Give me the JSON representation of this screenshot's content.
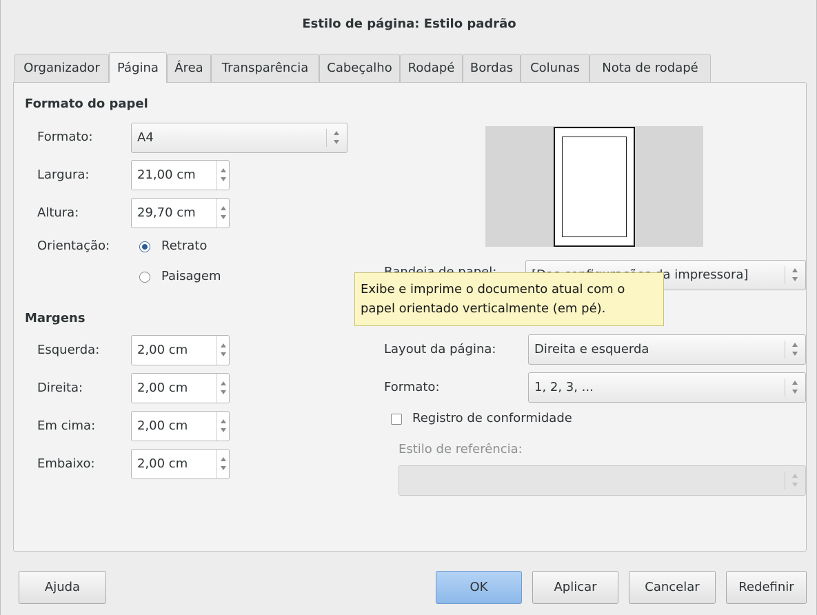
{
  "window": {
    "title": "Estilo de página: Estilo padrão"
  },
  "tabs": [
    {
      "label": "Organizador",
      "active": false
    },
    {
      "label": "Página",
      "active": true
    },
    {
      "label": "Área",
      "active": false
    },
    {
      "label": "Transparência",
      "active": false
    },
    {
      "label": "Cabeçalho",
      "active": false
    },
    {
      "label": "Rodapé",
      "active": false
    },
    {
      "label": "Bordas",
      "active": false
    },
    {
      "label": "Colunas",
      "active": false
    },
    {
      "label": "Nota de rodapé",
      "active": false
    }
  ],
  "paper": {
    "section_title": "Formato do papel",
    "format_label": "Formato:",
    "format_value": "A4",
    "width_label": "Largura:",
    "width_value": "21,00 cm",
    "height_label": "Altura:",
    "height_value": "29,70 cm",
    "orientation_label": "Orientação:",
    "portrait_label": "Retrato",
    "portrait_checked": true,
    "landscape_label": "Paisagem",
    "landscape_checked": false,
    "tray_label": "Bandeja de papel:",
    "tray_value": "[Das configurações da impressora]"
  },
  "margins": {
    "section_title": "Margens",
    "left_label": "Esquerda:",
    "left_value": "2,00 cm",
    "right_label": "Direita:",
    "right_value": "2,00 cm",
    "top_label": "Em cima:",
    "top_value": "2,00 cm",
    "bottom_label": "Embaixo:",
    "bottom_value": "2,00 cm"
  },
  "layout": {
    "page_layout_label": "Layout da página:",
    "page_layout_value": "Direita e esquerda",
    "format_label": "Formato:",
    "format_value": "1, 2, 3, ...",
    "register_label": "Registro de conformidade",
    "register_checked": false,
    "reference_style_label": "Estilo de referência:",
    "reference_style_value": ""
  },
  "tooltip": {
    "text_line1": "Exibe e imprime o documento atual com o",
    "text_line2": "papel orientado verticalmente (em pé)."
  },
  "buttons": {
    "help": "Ajuda",
    "ok": "OK",
    "apply": "Aplicar",
    "cancel": "Cancelar",
    "reset": "Redefinir"
  },
  "colors": {
    "dialog_bg": "#ededed",
    "panel_bg": "#f3f3f3",
    "tooltip_bg": "#fbf6c4",
    "ok_button": "#a3c7ef"
  }
}
